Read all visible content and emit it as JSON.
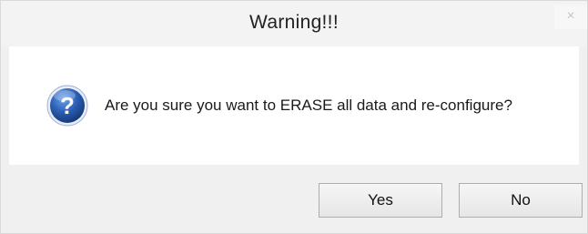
{
  "dialog": {
    "title": "Warning!!!",
    "close_glyph": "×",
    "icon": "question-icon",
    "message": "Are you sure you want to ERASE all data and re-configure?",
    "buttons": {
      "yes_label": "Yes",
      "no_label": "No"
    }
  },
  "colors": {
    "icon_blue": "#2b5fb4",
    "background": "#f0f0f0",
    "content_background": "#ffffff"
  }
}
